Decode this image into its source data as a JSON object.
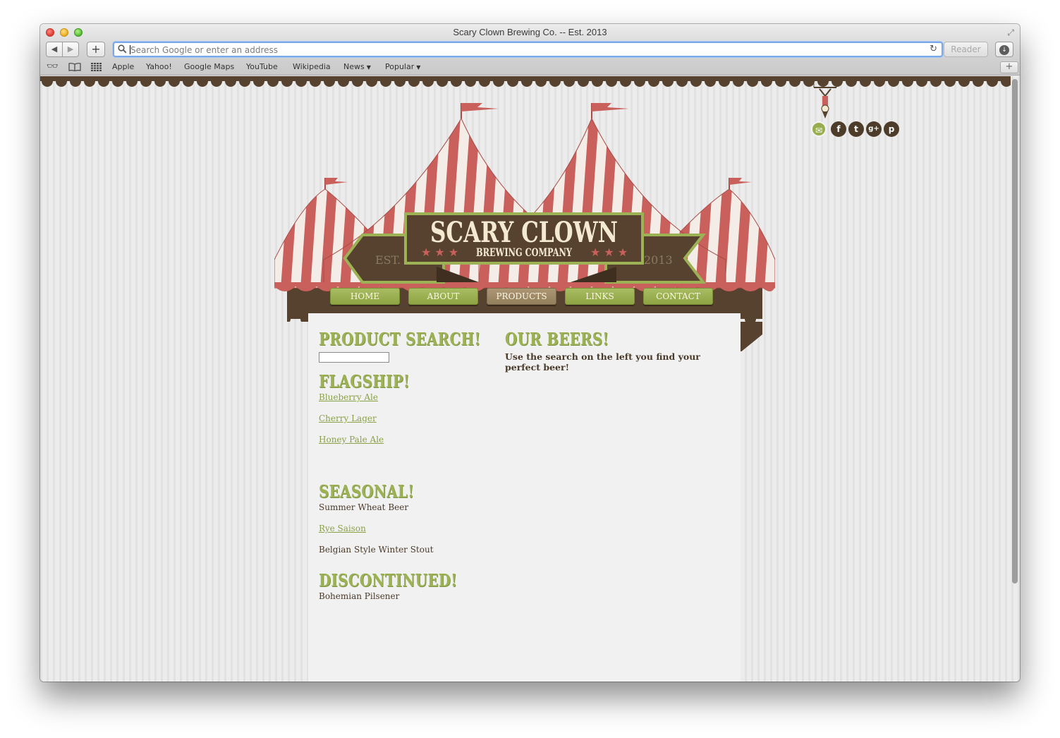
{
  "browser": {
    "window_title": "Scary Clown Brewing Co. -- Est. 2013",
    "address_placeholder": "Search Google or enter an address",
    "reader_label": "Reader",
    "bookmarks": [
      "Apple",
      "Yahoo!",
      "Google Maps",
      "YouTube",
      "Wikipedia",
      "News",
      "Popular"
    ],
    "icons": [
      "back-icon",
      "forward-icon",
      "plus-icon",
      "search-icon",
      "reload-icon",
      "download-icon",
      "reading-list-icon",
      "bookmarks-icon",
      "top-sites-icon"
    ]
  },
  "site": {
    "logo": {
      "name_line1": "SCARY CLOWN",
      "name_line2": "BREWING COMPANY",
      "est": "EST.",
      "year": "2013"
    },
    "social_icons": [
      "email-icon",
      "facebook-icon",
      "twitter-icon",
      "google-plus-icon",
      "pinterest-icon"
    ],
    "nav": [
      {
        "label": "HOME"
      },
      {
        "label": "ABOUT"
      },
      {
        "label": "PRODUCTS",
        "active": true
      },
      {
        "label": "LINKS"
      },
      {
        "label": "CONTACT"
      }
    ],
    "product_search": {
      "heading": "PRODUCT SEARCH!",
      "value": ""
    },
    "flagship": {
      "heading": "FLAGSHIP!",
      "items": [
        "Blueberry Ale",
        "Cherry Lager",
        "Honey Pale Ale"
      ]
    },
    "seasonal": {
      "heading": "SEASONAL!",
      "items": [
        "Summer Wheat Beer",
        "Rye Saison",
        "Belgian Style Winter Stout"
      ]
    },
    "discontinued": {
      "heading": "DISCONTINUED!",
      "items": [
        "Bohemian Pilsener"
      ]
    },
    "our_beers": {
      "heading": "OUR BEERS!",
      "text": "Use the search on the left you find your perfect beer!"
    },
    "colors": {
      "tent_red": "#c9605c",
      "brown": "#56422f",
      "olive": "#9db155",
      "cream": "#f4ead2"
    }
  }
}
